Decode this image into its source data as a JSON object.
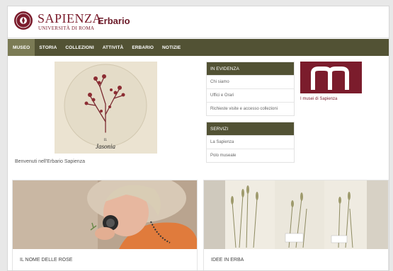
{
  "header": {
    "brand_name": "SAPIENZA",
    "brand_sub": "UNIVERSITÀ DI ROMA",
    "site_title": "Erbario"
  },
  "nav": {
    "items": [
      {
        "label": "MUSEO",
        "active": true
      },
      {
        "label": "STORIA",
        "active": false
      },
      {
        "label": "COLLEZIONI",
        "active": false
      },
      {
        "label": "ATTIVITÀ",
        "active": false
      },
      {
        "label": "ERBARIO",
        "active": false
      },
      {
        "label": "NOTIZIE",
        "active": false
      }
    ]
  },
  "hero": {
    "specimen_label": "Jasonia",
    "caption": "Benvenuti nell'Erbario Sapienza"
  },
  "in_evidenza": {
    "title": "IN EVIDENZA",
    "items": [
      "Chi siamo",
      "Uffici e Orari",
      "Richieste visite e accesso collezioni"
    ]
  },
  "servizi": {
    "title": "SERVIZI",
    "items": [
      "La Sapienza",
      "Polo museale"
    ]
  },
  "musei": {
    "caption": "I musei di Sapienza"
  },
  "cards": [
    {
      "label": "IL NOME DELLE ROSE"
    },
    {
      "label": "IDEE IN ERBA"
    }
  ],
  "colors": {
    "brand": "#7b1c2c",
    "nav_bg": "#525234",
    "nav_active": "#7b7b55"
  }
}
